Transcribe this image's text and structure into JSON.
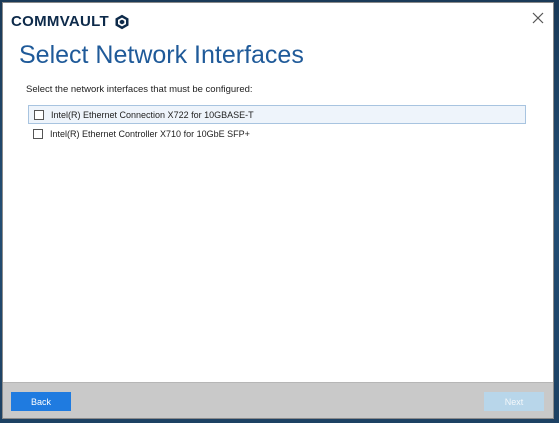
{
  "app": {
    "brand": "COMMVAULT",
    "colors": {
      "title": "#1f5a99",
      "primary_button": "#1f7be0",
      "disabled_button": "#b8d6ea",
      "footer": "#c9c9c9"
    }
  },
  "page": {
    "title": "Select Network Interfaces",
    "instructions": "Select the network interfaces that must be configured:"
  },
  "interfaces": [
    {
      "label": "Intel(R) Ethernet Connection X722 for 10GBASE-T",
      "checked": false,
      "highlighted": true
    },
    {
      "label": "Intel(R) Ethernet Controller X710 for 10GbE SFP+",
      "checked": false,
      "highlighted": false
    }
  ],
  "footer": {
    "back_label": "Back",
    "next_label": "Next",
    "next_enabled": false
  },
  "icons": {
    "logo": "commvault-logo-icon",
    "close": "close-icon"
  }
}
